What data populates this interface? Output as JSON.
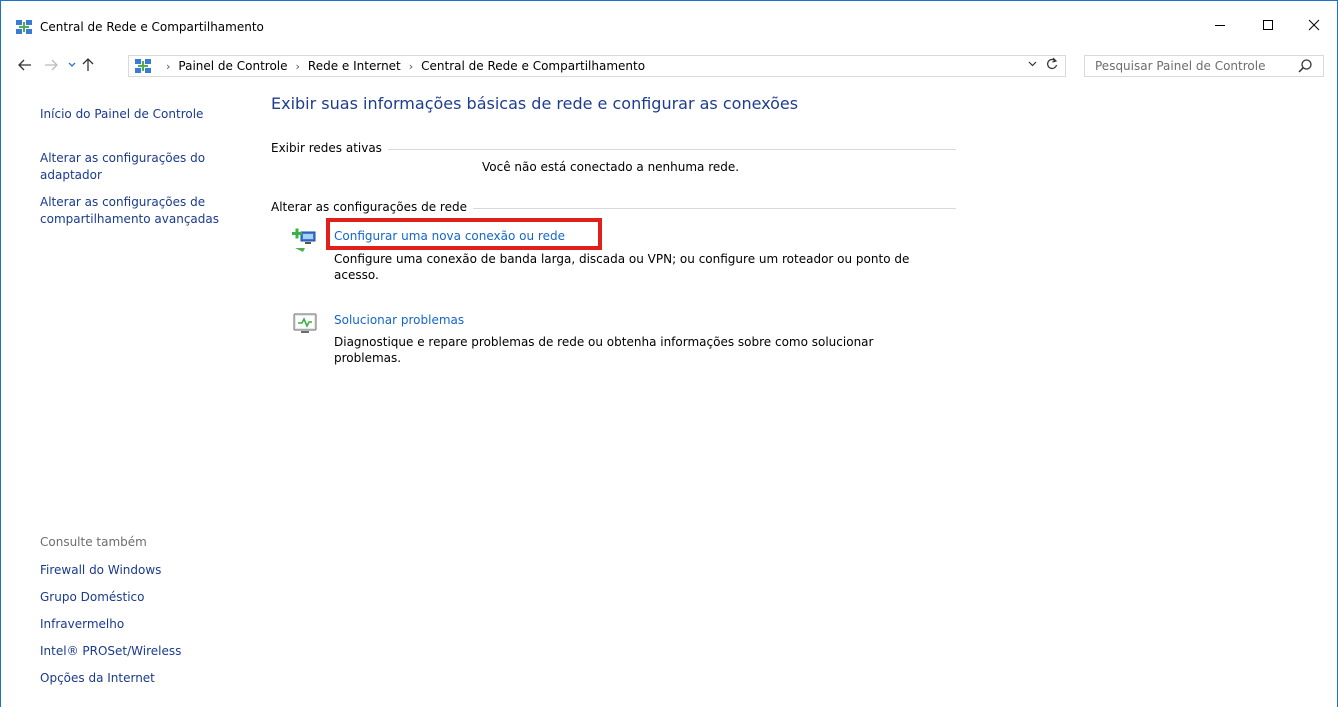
{
  "window": {
    "title": "Central de Rede e Compartilhamento"
  },
  "address": {
    "crumbs": [
      "Painel de Controle",
      "Rede e Internet",
      "Central de Rede e Compartilhamento"
    ],
    "search_placeholder": "Pesquisar Painel de Controle"
  },
  "sidebar": {
    "home": "Início do Painel de Controle",
    "adapter_line1": "Alterar as configurações do",
    "adapter_line2": "adaptador",
    "sharing_line1": "Alterar as configurações de",
    "sharing_line2": "compartilhamento avançadas",
    "see_also_title": "Consulte também",
    "see_also": [
      "Firewall do Windows",
      "Grupo Doméstico",
      "Infravermelho",
      "Intel® PROSet/Wireless",
      "Opções da Internet"
    ]
  },
  "main": {
    "title": "Exibir suas informações básicas de rede e configurar as conexões",
    "active_networks_label": "Exibir redes ativas",
    "no_network": "Você não está conectado a nenhuma rede.",
    "change_settings_label": "Alterar as configurações de rede",
    "tasks": [
      {
        "link": "Configurar uma nova conexão ou rede",
        "desc_line1": "Configure uma conexão de banda larga, discada ou VPN; ou configure um roteador ou ponto de",
        "desc_line2": "acesso."
      },
      {
        "link": "Solucionar problemas",
        "desc_line1": "Diagnostique e repare problemas de rede ou obtenha informações sobre como solucionar",
        "desc_line2": "problemas."
      }
    ]
  },
  "colors": {
    "link": "#1566c8",
    "nav_link": "#1a3a8c",
    "title": "#1e3d90",
    "highlight": "#e0201b"
  }
}
